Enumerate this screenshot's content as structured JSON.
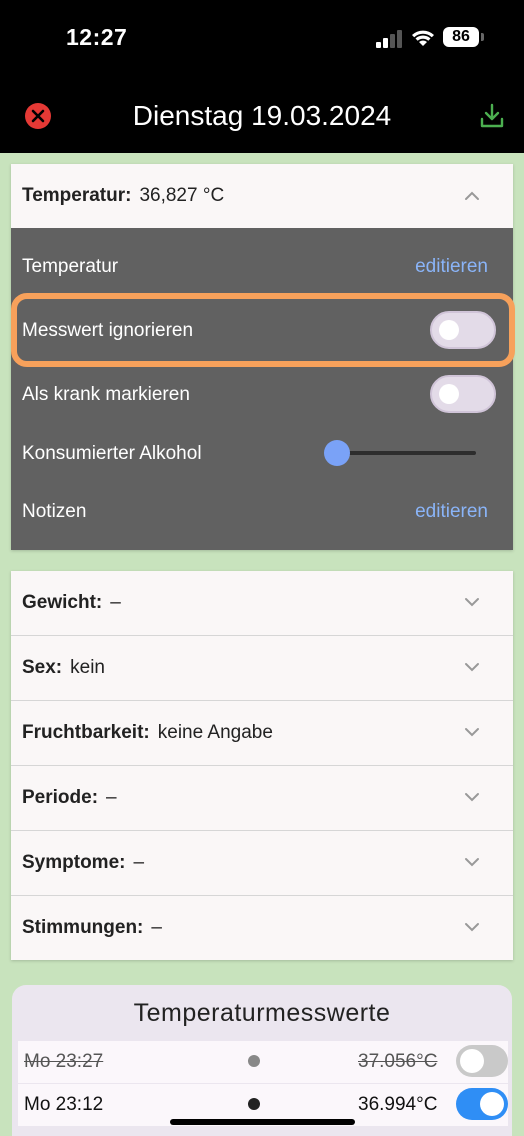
{
  "status_bar": {
    "time": "12:27",
    "battery": "86"
  },
  "header": {
    "title": "Dienstag 19.03.2024",
    "close_icon": "close-circle-icon",
    "download_icon": "download-icon"
  },
  "temperature_card": {
    "label": "Temperatur:",
    "value": "36,827 °C",
    "expanded": true,
    "rows": {
      "temperature": {
        "label": "Temperatur",
        "action": "editieren"
      },
      "ignore": {
        "label": "Messwert ignorieren",
        "on": false
      },
      "sick": {
        "label": "Als krank markieren",
        "on": false
      },
      "alcohol": {
        "label": "Konsumierter Alkohol",
        "level": 0
      },
      "notes": {
        "label": "Notizen",
        "action": "editieren"
      }
    }
  },
  "sections": [
    {
      "label": "Gewicht:",
      "value": "–"
    },
    {
      "label": "Sex:",
      "value": "kein"
    },
    {
      "label": "Fruchtbarkeit:",
      "value": "keine Angabe"
    },
    {
      "label": "Periode:",
      "value": "–"
    },
    {
      "label": "Symptome:",
      "value": "–"
    },
    {
      "label": "Stimmungen:",
      "value": "–"
    }
  ],
  "measurements": {
    "title": "Temperaturmesswerte",
    "rows": [
      {
        "time": "Mo 23:27",
        "value": "37.056°C",
        "ignored": true,
        "enabled": false
      },
      {
        "time": "Mo 23:12",
        "value": "36.994°C",
        "ignored": false,
        "enabled": true
      }
    ]
  },
  "colors": {
    "accent": "#2f8ef5",
    "highlight": "#f7a15b",
    "link": "#8ab4f8",
    "close": "#e53935",
    "download": "#4caf50",
    "background": "#c8e3bd"
  }
}
